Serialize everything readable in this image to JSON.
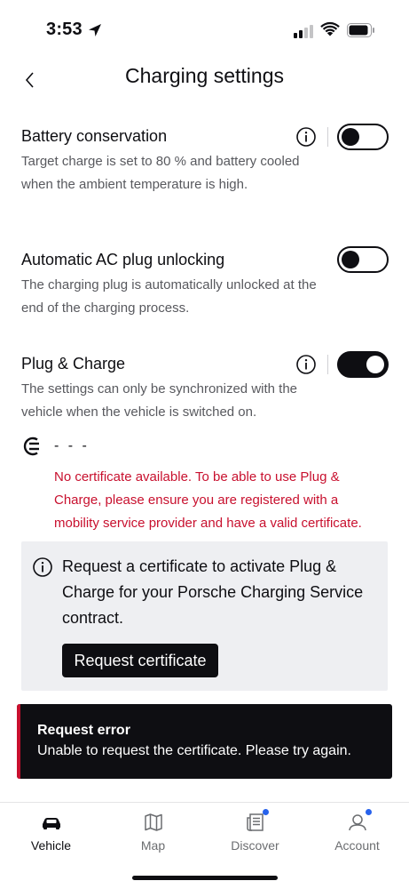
{
  "status_bar": {
    "time": "3:53"
  },
  "header": {
    "title": "Charging settings"
  },
  "settings": [
    {
      "title": "Battery conservation",
      "description": "Target charge is set to 80 % and battery cooled when the ambient temperature is high.",
      "enabled": false,
      "has_info": true
    },
    {
      "title": "Automatic AC plug unlocking",
      "description": "The charging plug is automatically unlocked at the end of the charging process.",
      "enabled": false,
      "has_info": false
    },
    {
      "title": "Plug & Charge",
      "description": "The settings can only be synchronized with the vehicle when the vehicle is switched on.",
      "enabled": true,
      "has_info": true
    }
  ],
  "certificate": {
    "value": "- - -",
    "error": "No certificate available. To be able to use Plug & Charge, please ensure you are registered with a mobility service provider and have a valid certificate."
  },
  "info_box": {
    "text": "Request a certificate to activate Plug & Charge for your Porsche Charging Service contract.",
    "button_label": "Request certificate"
  },
  "toast": {
    "title": "Request error",
    "message": "Unable to request the certificate. Please try again."
  },
  "tabs": [
    {
      "label": "Vehicle",
      "icon": "car-icon",
      "active": true,
      "badge": false
    },
    {
      "label": "Map",
      "icon": "map-icon",
      "active": false,
      "badge": false
    },
    {
      "label": "Discover",
      "icon": "news-icon",
      "active": false,
      "badge": true
    },
    {
      "label": "Account",
      "icon": "user-icon",
      "active": false,
      "badge": true
    }
  ],
  "colors": {
    "accent": "#0e0e12",
    "error": "#c8102e",
    "badge": "#2762ec",
    "info_box_bg": "#eeeff2"
  }
}
